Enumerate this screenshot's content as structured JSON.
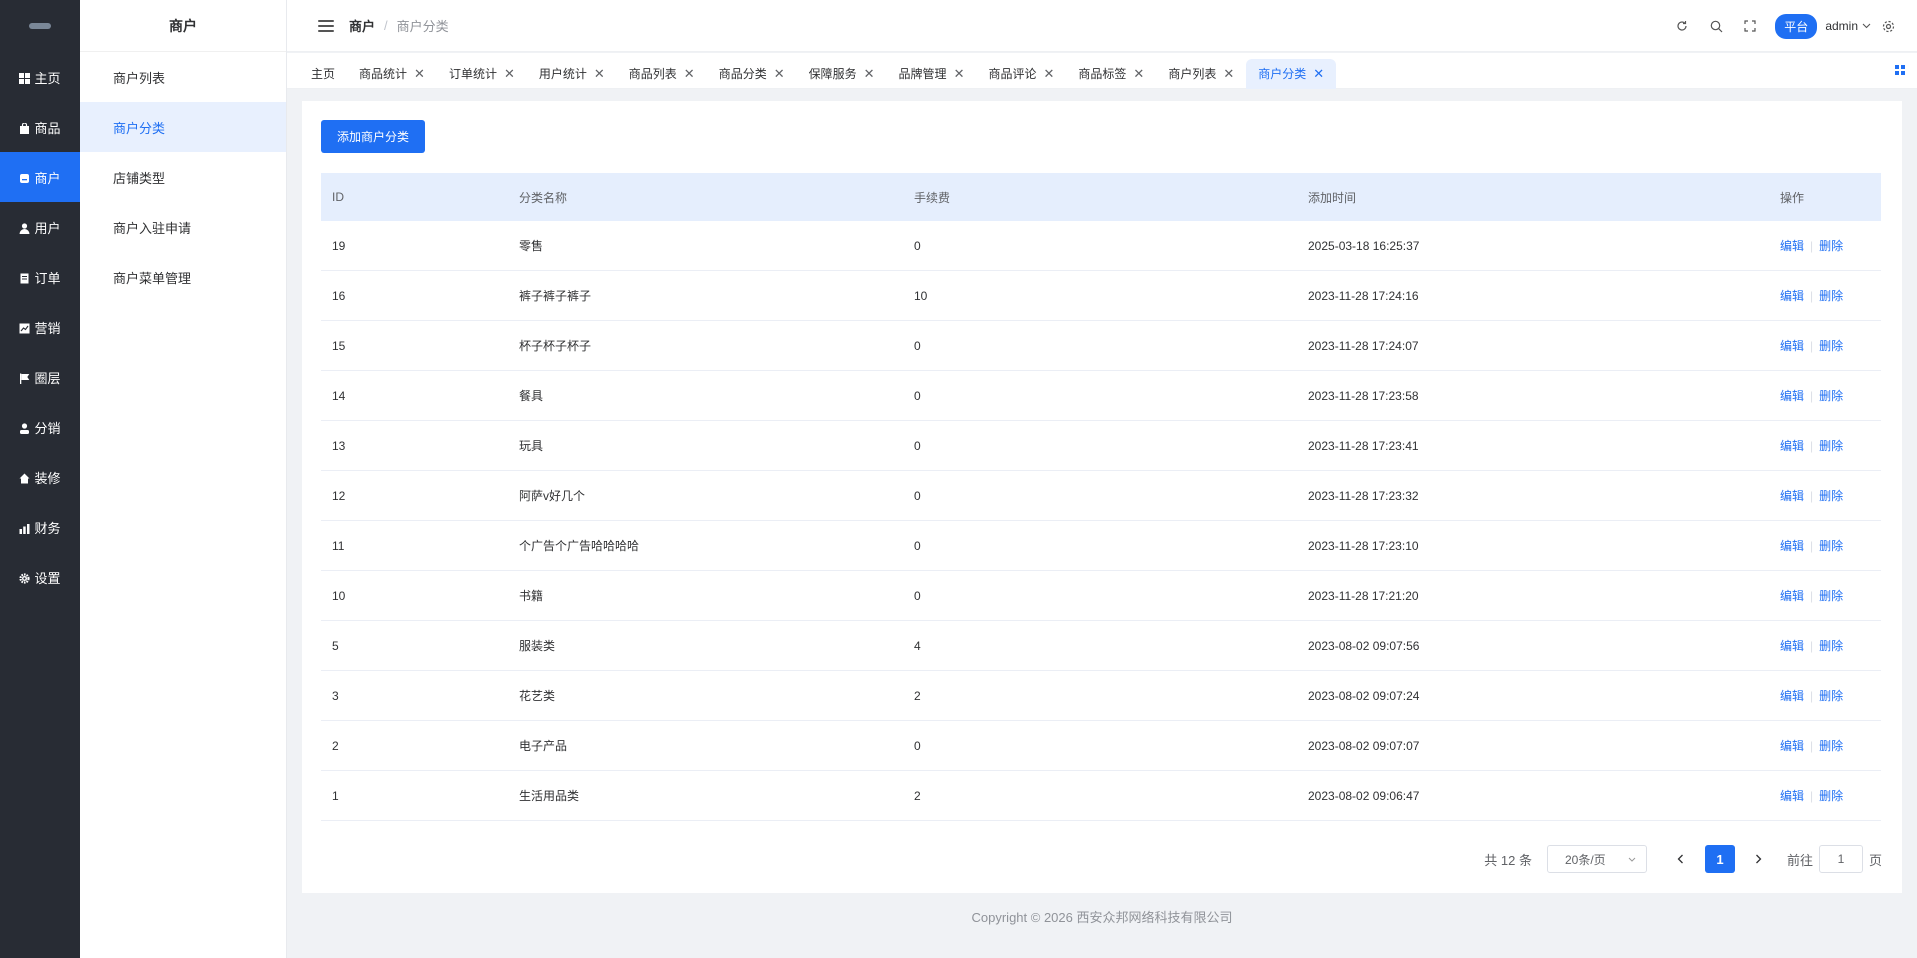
{
  "rail": {
    "items": [
      {
        "label": "主页",
        "icon": "grid-icon"
      },
      {
        "label": "商品",
        "icon": "bag-icon"
      },
      {
        "label": "商户",
        "icon": "store-icon",
        "active": true
      },
      {
        "label": "用户",
        "icon": "user-icon"
      },
      {
        "label": "订单",
        "icon": "document-icon"
      },
      {
        "label": "营销",
        "icon": "chart-icon"
      },
      {
        "label": "圈层",
        "icon": "flag-icon"
      },
      {
        "label": "分销",
        "icon": "person-icon"
      },
      {
        "label": "装修",
        "icon": "home-icon"
      },
      {
        "label": "财务",
        "icon": "finance-icon"
      },
      {
        "label": "设置",
        "icon": "gear-icon"
      }
    ]
  },
  "submenu": {
    "title": "商户",
    "items": [
      {
        "label": "商户列表"
      },
      {
        "label": "商户分类",
        "active": true
      },
      {
        "label": "店铺类型"
      },
      {
        "label": "商户入驻申请"
      },
      {
        "label": "商户菜单管理"
      }
    ]
  },
  "header": {
    "breadcrumb": [
      "商户",
      "商户分类"
    ],
    "platform_label": "平台",
    "user": "admin"
  },
  "tags": [
    {
      "label": "主页",
      "closable": false
    },
    {
      "label": "商品统计",
      "closable": true
    },
    {
      "label": "订单统计",
      "closable": true
    },
    {
      "label": "用户统计",
      "closable": true
    },
    {
      "label": "商品列表",
      "closable": true
    },
    {
      "label": "商品分类",
      "closable": true
    },
    {
      "label": "保障服务",
      "closable": true
    },
    {
      "label": "品牌管理",
      "closable": true
    },
    {
      "label": "商品评论",
      "closable": true
    },
    {
      "label": "商品标签",
      "closable": true
    },
    {
      "label": "商户列表",
      "closable": true
    },
    {
      "label": "商户分类",
      "closable": true,
      "active": true
    }
  ],
  "main": {
    "add_button": "添加商户分类",
    "columns": [
      "ID",
      "分类名称",
      "手续费",
      "添加时间",
      "操作"
    ],
    "rows": [
      {
        "id": "19",
        "name": "零售",
        "fee": "0",
        "time": "2025-03-18 16:25:37"
      },
      {
        "id": "16",
        "name": "裤子裤子裤子",
        "fee": "10",
        "time": "2023-11-28 17:24:16"
      },
      {
        "id": "15",
        "name": "杯子杯子杯子",
        "fee": "0",
        "time": "2023-11-28 17:24:07"
      },
      {
        "id": "14",
        "name": "餐具",
        "fee": "0",
        "time": "2023-11-28 17:23:58"
      },
      {
        "id": "13",
        "name": "玩具",
        "fee": "0",
        "time": "2023-11-28 17:23:41"
      },
      {
        "id": "12",
        "name": "阿萨v好几个",
        "fee": "0",
        "time": "2023-11-28 17:23:32"
      },
      {
        "id": "11",
        "name": "个广告个广告哈哈哈哈",
        "fee": "0",
        "time": "2023-11-28 17:23:10"
      },
      {
        "id": "10",
        "name": "书籍",
        "fee": "0",
        "time": "2023-11-28 17:21:20"
      },
      {
        "id": "5",
        "name": "服装类",
        "fee": "4",
        "time": "2023-08-02 09:07:56"
      },
      {
        "id": "3",
        "name": "花艺类",
        "fee": "2",
        "time": "2023-08-02 09:07:24"
      },
      {
        "id": "2",
        "name": "电子产品",
        "fee": "0",
        "time": "2023-08-02 09:07:07"
      },
      {
        "id": "1",
        "name": "生活用品类",
        "fee": "2",
        "time": "2023-08-02 09:06:47"
      }
    ],
    "edit_label": "编辑",
    "delete_label": "删除"
  },
  "pagination": {
    "total": "共 12 条",
    "page_size": "20条/页",
    "current_page": "1",
    "goto_label": "前往",
    "goto_value": "1",
    "page_suffix": "页"
  },
  "footer": {
    "copyright": "Copyright © 2026 西安众邦网络科技有限公司"
  },
  "colors": {
    "primary": "#1f6ff3",
    "rail_bg": "#282c34",
    "table_header_bg": "#e5eefd"
  }
}
